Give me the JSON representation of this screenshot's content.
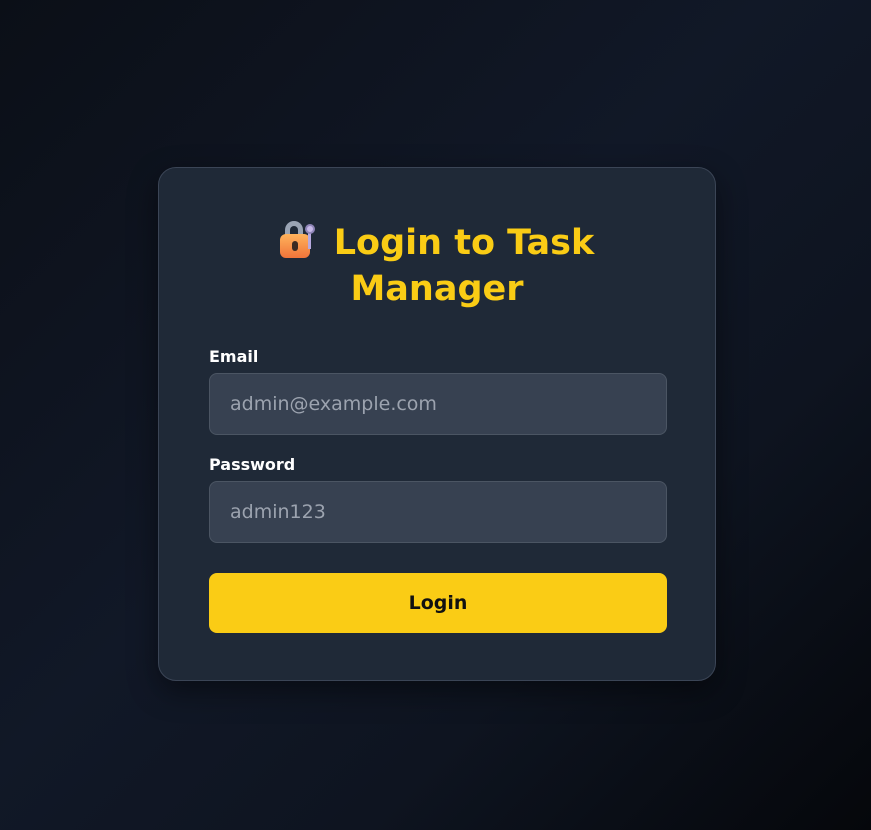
{
  "login": {
    "title": "Login to Task Manager",
    "title_icon": "lock-with-key-icon",
    "email": {
      "label": "Email",
      "placeholder": "admin@example.com",
      "value": ""
    },
    "password": {
      "label": "Password",
      "placeholder": "admin123",
      "value": ""
    },
    "submit_label": "Login"
  },
  "colors": {
    "accent": "#facc15",
    "card_background": "#1f2937",
    "input_background": "#374151",
    "page_background": "#0b0f17"
  }
}
